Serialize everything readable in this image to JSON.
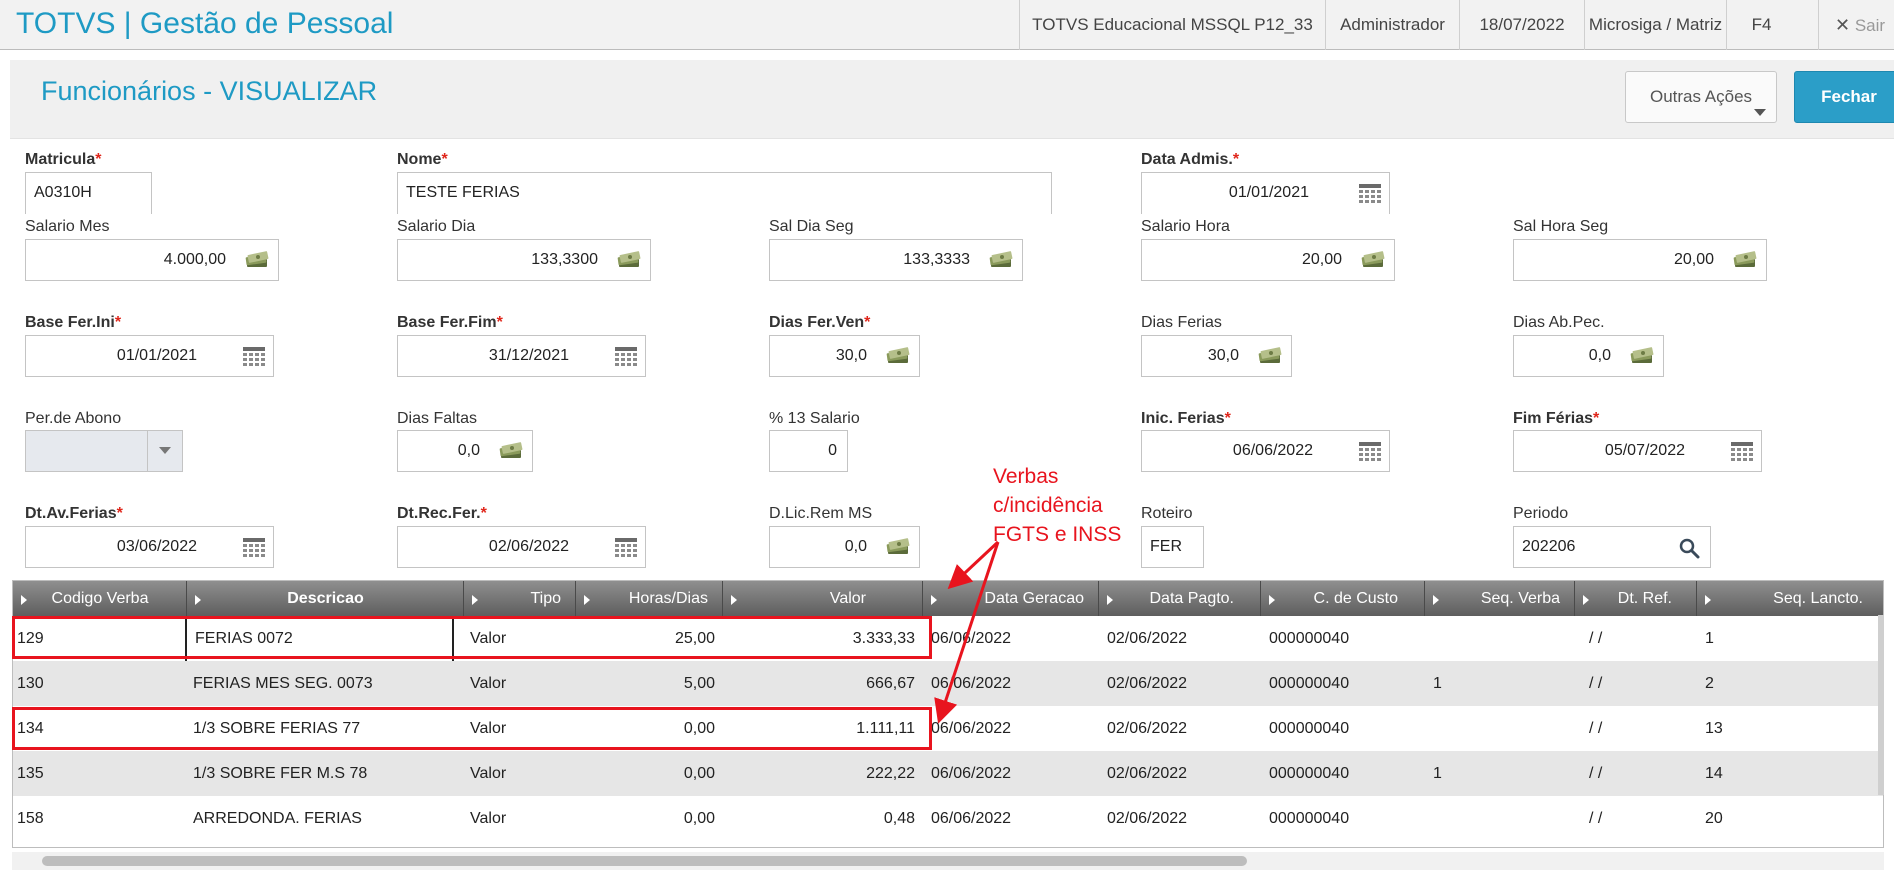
{
  "app": {
    "title": "TOTVS | Gestão de Pessoal",
    "environment": "TOTVS Educacional MSSQL P12_33",
    "user": "Administrador",
    "date": "18/07/2022",
    "branch": "Microsiga / Matriz",
    "shortcut": "F4",
    "exit_label": "Sair"
  },
  "page": {
    "title": "Funcionários - VISUALIZAR",
    "other_actions": "Outras Ações",
    "close": "Fechar"
  },
  "fields": {
    "matricula": {
      "label": "Matricula",
      "value": "A0310H"
    },
    "nome": {
      "label": "Nome",
      "value": "TESTE FERIAS"
    },
    "data_admis": {
      "label": "Data Admis.",
      "value": "01/01/2021"
    },
    "salario_mes": {
      "label": "Salario Mes",
      "value": "4.000,00"
    },
    "salario_dia": {
      "label": "Salario Dia",
      "value": "133,3300"
    },
    "sal_dia_seg": {
      "label": "Sal Dia Seg",
      "value": "133,3333"
    },
    "salario_hora": {
      "label": "Salario Hora",
      "value": "20,00"
    },
    "sal_hora_seg": {
      "label": "Sal Hora Seg",
      "value": "20,00"
    },
    "base_fer_ini": {
      "label": "Base Fer.Ini",
      "value": "01/01/2021"
    },
    "base_fer_fim": {
      "label": "Base Fer.Fim",
      "value": "31/12/2021"
    },
    "dias_fer_ven": {
      "label": "Dias Fer.Ven",
      "value": "30,0"
    },
    "dias_ferias": {
      "label": "Dias Ferias",
      "value": "30,0"
    },
    "dias_ab_pec": {
      "label": "Dias Ab.Pec.",
      "value": "0,0"
    },
    "per_de_abono": {
      "label": "Per.de Abono",
      "value": ""
    },
    "dias_faltas": {
      "label": "Dias Faltas",
      "value": "0,0"
    },
    "pct_13_salario": {
      "label": "% 13 Salario",
      "value": "0"
    },
    "inic_ferias": {
      "label": "Inic. Ferias",
      "value": "06/06/2022"
    },
    "fim_ferias": {
      "label": "Fim Férias",
      "value": "05/07/2022"
    },
    "dt_av_ferias": {
      "label": "Dt.Av.Ferias",
      "value": "03/06/2022"
    },
    "dt_rec_fer": {
      "label": "Dt.Rec.Fer.",
      "value": "02/06/2022"
    },
    "d_lic_rem_ms": {
      "label": "D.Lic.Rem MS",
      "value": "0,0"
    },
    "roteiro": {
      "label": "Roteiro",
      "value": "FER"
    },
    "periodo": {
      "label": "Periodo",
      "value": "202206"
    }
  },
  "grid": {
    "columns": [
      "Codigo Verba",
      "Descricao",
      "Tipo",
      "Horas/Dias",
      "Valor",
      "Data Geracao",
      "Data Pagto.",
      "C. de Custo",
      "Seq. Verba",
      "Dt. Ref.",
      "Seq. Lancto."
    ],
    "rows": [
      {
        "codigo": "129",
        "descricao": "FERIAS 0072",
        "tipo": "Valor",
        "horas": "25,00",
        "valor": "3.333,33",
        "data_geracao": "06/06/2022",
        "data_pagto": "02/06/2022",
        "custo": "000000040",
        "seq_verba": "",
        "dt_ref": "/ /",
        "seq_lancto": "1"
      },
      {
        "codigo": "130",
        "descricao": "FERIAS MES SEG. 0073",
        "tipo": "Valor",
        "horas": "5,00",
        "valor": "666,67",
        "data_geracao": "06/06/2022",
        "data_pagto": "02/06/2022",
        "custo": "000000040",
        "seq_verba": "1",
        "dt_ref": "/ /",
        "seq_lancto": "2"
      },
      {
        "codigo": "134",
        "descricao": "1/3 SOBRE FERIAS 77",
        "tipo": "Valor",
        "horas": "0,00",
        "valor": "1.111,11",
        "data_geracao": "06/06/2022",
        "data_pagto": "02/06/2022",
        "custo": "000000040",
        "seq_verba": "",
        "dt_ref": "/ /",
        "seq_lancto": "13"
      },
      {
        "codigo": "135",
        "descricao": "1/3 SOBRE FER M.S 78",
        "tipo": "Valor",
        "horas": "0,00",
        "valor": "222,22",
        "data_geracao": "06/06/2022",
        "data_pagto": "02/06/2022",
        "custo": "000000040",
        "seq_verba": "1",
        "dt_ref": "/ /",
        "seq_lancto": "14"
      },
      {
        "codigo": "158",
        "descricao": "ARREDONDA. FERIAS",
        "tipo": "Valor",
        "horas": "0,00",
        "valor": "0,48",
        "data_geracao": "06/06/2022",
        "data_pagto": "02/06/2022",
        "custo": "000000040",
        "seq_verba": "",
        "dt_ref": "/ /",
        "seq_lancto": "20"
      }
    ]
  },
  "annotation": {
    "line1": "Verbas",
    "line2": "c/incidência",
    "line3": "FGTS e INSS",
    "color": "#e8141e"
  },
  "icons": {
    "money": "money-stack-icon",
    "calendar": "calendar-icon",
    "search": "search-icon",
    "close": "close-icon"
  }
}
